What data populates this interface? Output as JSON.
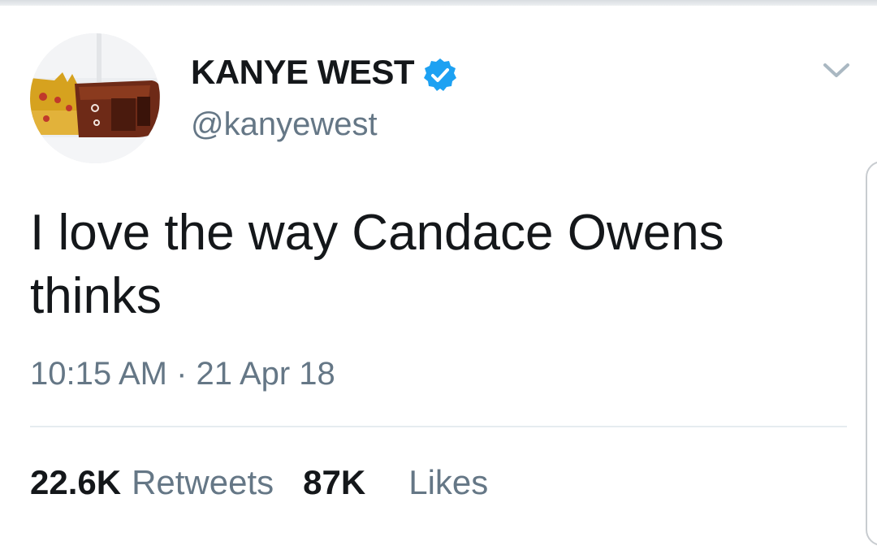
{
  "tweet": {
    "author": {
      "display_name": "KANYE WEST",
      "handle": "@kanyewest",
      "verified": true,
      "avatar_icon": "crowned-bust-avatar"
    },
    "text": "I love the way Candace Owens thinks",
    "timestamp": "10:15 AM · 21 Apr 18",
    "stats": {
      "retweets_count": "22.6K",
      "retweets_label": "Retweets",
      "likes_count": "87K",
      "likes_label": "Likes"
    }
  },
  "colors": {
    "text_primary": "#14171a",
    "text_secondary": "#657786",
    "verified_blue": "#1da1f2",
    "divider": "#e6ecf0"
  },
  "icons": {
    "verified": "verified-badge-icon",
    "menu": "chevron-down-icon"
  }
}
